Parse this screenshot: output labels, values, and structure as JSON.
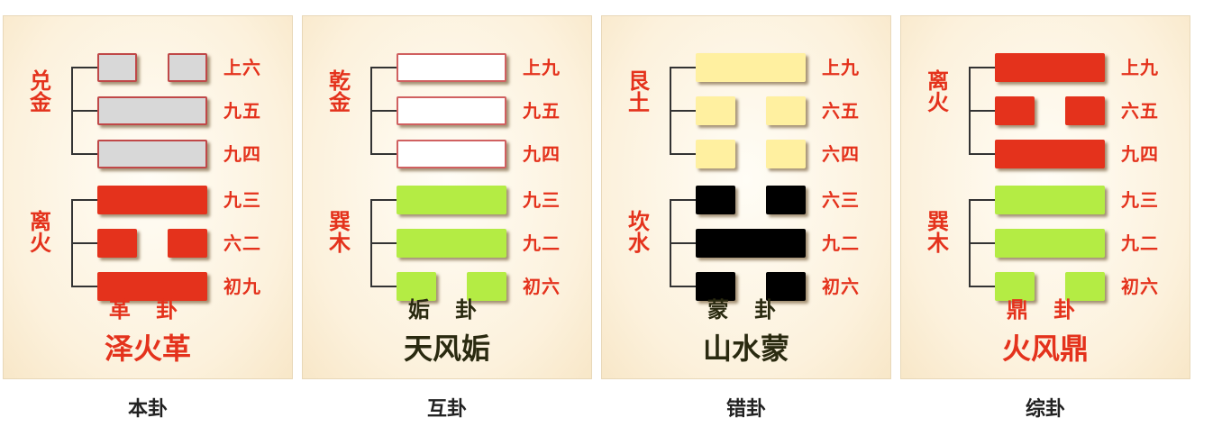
{
  "panels": [
    {
      "upper_trigram": [
        "兑",
        "金"
      ],
      "lower_trigram": [
        "离",
        "火"
      ],
      "yao_labels": [
        "上六",
        "九五",
        "九四",
        "九三",
        "六二",
        "初九"
      ],
      "lines_yin": [
        true,
        false,
        false,
        false,
        true,
        false
      ],
      "line_colors": [
        "#d8d8d8",
        "#d8d8d8",
        "#d8d8d8",
        "#e4321c",
        "#e4321c",
        "#e4321c"
      ],
      "line_border": [
        "#c04848",
        "#c04848",
        "#c04848",
        "#e4321c",
        "#e4321c",
        "#e4321c"
      ],
      "gua_short": "革 卦",
      "gua_full": "泽火革",
      "text_color": "#e4321c",
      "caption": "本卦"
    },
    {
      "upper_trigram": [
        "乾",
        "金"
      ],
      "lower_trigram": [
        "巽",
        "木"
      ],
      "yao_labels": [
        "上九",
        "九五",
        "九四",
        "九三",
        "九二",
        "初六"
      ],
      "lines_yin": [
        false,
        false,
        false,
        false,
        false,
        true
      ],
      "line_colors": [
        "#ffffff",
        "#ffffff",
        "#ffffff",
        "#b4ec44",
        "#b4ec44",
        "#b4ec44"
      ],
      "line_border": [
        "#d06060",
        "#d06060",
        "#d06060",
        "#b4ec44",
        "#b4ec44",
        "#b4ec44"
      ],
      "gua_short": "姤 卦",
      "gua_full": "天风姤",
      "text_color": "#2a2a10",
      "caption": "互卦"
    },
    {
      "upper_trigram": [
        "艮",
        "土"
      ],
      "lower_trigram": [
        "坎",
        "水"
      ],
      "yao_labels": [
        "上九",
        "六五",
        "六四",
        "六三",
        "九二",
        "初六"
      ],
      "lines_yin": [
        false,
        true,
        true,
        true,
        false,
        true
      ],
      "line_colors": [
        "#fff0a0",
        "#fff0a0",
        "#fff0a0",
        "#000000",
        "#000000",
        "#000000"
      ],
      "line_border": [
        "#fff0a0",
        "#fff0a0",
        "#fff0a0",
        "#000000",
        "#000000",
        "#000000"
      ],
      "gua_short": "蒙 卦",
      "gua_full": "山水蒙",
      "text_color": "#2a2a10",
      "caption": "错卦"
    },
    {
      "upper_trigram": [
        "离",
        "火"
      ],
      "lower_trigram": [
        "巽",
        "木"
      ],
      "yao_labels": [
        "上九",
        "六五",
        "九四",
        "九三",
        "九二",
        "初六"
      ],
      "lines_yin": [
        false,
        true,
        false,
        false,
        false,
        true
      ],
      "line_colors": [
        "#e4321c",
        "#e4321c",
        "#e4321c",
        "#b4ec44",
        "#b4ec44",
        "#b4ec44"
      ],
      "line_border": [
        "#e4321c",
        "#e4321c",
        "#e4321c",
        "#b4ec44",
        "#b4ec44",
        "#b4ec44"
      ],
      "gua_short": "鼎 卦",
      "gua_full": "火风鼎",
      "text_color": "#e4321c",
      "caption": "综卦"
    }
  ]
}
